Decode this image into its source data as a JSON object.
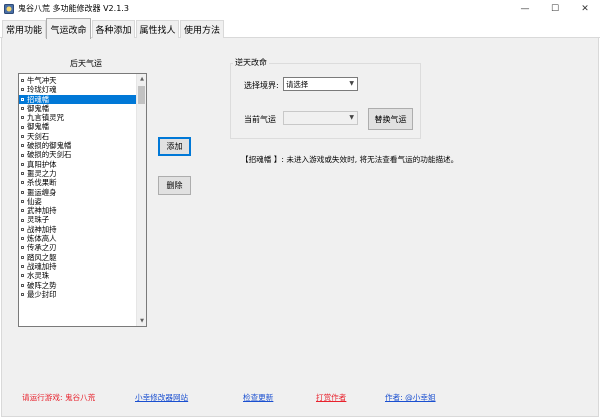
{
  "window": {
    "title": "鬼谷八荒 多功能修改器 V2.1.3",
    "minimize": "—",
    "maximize": "☐",
    "close": "✕"
  },
  "tabs": [
    {
      "label": "常用功能"
    },
    {
      "label": "气运改命"
    },
    {
      "label": "各种添加"
    },
    {
      "label": "属性找人"
    },
    {
      "label": "使用方法"
    }
  ],
  "list": {
    "title": "后天气运",
    "items": [
      "牛气冲天",
      "玲珑灯魂",
      "招魂幡",
      "御鬼幡",
      "九言镇灵咒",
      "御鬼幡",
      "天剑石",
      "破损的御鬼幡",
      "破损的天剑石",
      "真阳护体",
      "噩灵之力",
      "杀伐果断",
      "噩运缠身",
      "仙姿",
      "武神加持",
      "灵珠子",
      "战神加持",
      "炼体高人",
      "传承之刃",
      "踏风之躯",
      "战魂加持",
      "水灵珠",
      "破阵之势",
      "最少封印"
    ],
    "selected_index": 2
  },
  "buttons": {
    "add": "添加",
    "delete": "删除",
    "replace": "替换气运"
  },
  "group": {
    "title": "逆天改命",
    "realm_label": "选择境界:",
    "realm_value": "请选择",
    "current_label": "当前气运",
    "current_value": ""
  },
  "description": "【招魂幡 】: 未进入游戏或失效时, 将无法查看气运的功能描述。",
  "footer": {
    "run_game": "请运行游戏: 鬼谷八荒",
    "site": "小幸修改器网站",
    "update": "检查更新",
    "donate": "打赏作者",
    "author": "作者: @小幸姐"
  }
}
